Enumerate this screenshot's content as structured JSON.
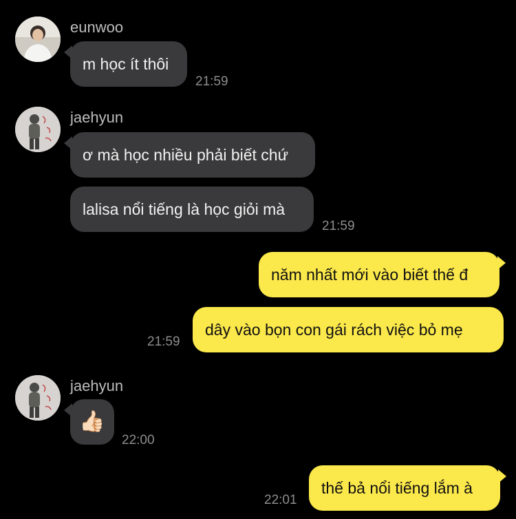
{
  "messages": [
    {
      "sender": "eunwoo",
      "text": "m học ít thôi",
      "time": "21:59"
    },
    {
      "sender": "jaehyun",
      "text": "ơ mà học nhiều phải biết chứ"
    },
    {
      "sender": "jaehyun",
      "text": "lalisa nổi tiếng là học giỏi mà",
      "time": "21:59"
    },
    {
      "sender": "me",
      "text": "năm nhất mới vào biết thế đ"
    },
    {
      "sender": "me",
      "text": "dây vào bọn con gái rách việc bỏ mẹ",
      "time": "21:59"
    },
    {
      "sender": "jaehyun",
      "text": "👍🏻",
      "time": "22:00"
    },
    {
      "sender": "me",
      "text": "thế bả nổi tiếng lắm à",
      "time": "22:01"
    }
  ],
  "colors": {
    "background": "#000000",
    "incoming_bubble": "#3a3a3c",
    "outgoing_bubble": "#fbe84a"
  }
}
